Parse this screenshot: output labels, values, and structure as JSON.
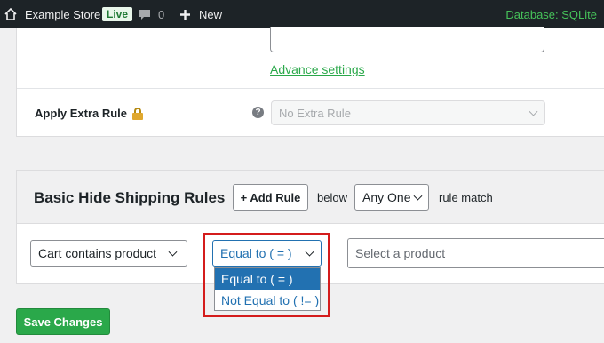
{
  "adminbar": {
    "site_name": "Example Store",
    "live_badge": "Live",
    "comment_count": "0",
    "new_label": "New",
    "database_label": "Database: SQLite",
    "icons": {
      "home": "home-icon",
      "comment": "comment-icon",
      "new": "plus-icon"
    }
  },
  "top_card": {
    "advance_link": "Advance settings",
    "extra_rule_label": "Apply Extra Rule",
    "extra_rule_placeholder": "No Extra Rule",
    "icons": {
      "lock": "lock-icon",
      "help": "help-icon"
    }
  },
  "rules": {
    "title": "Basic Hide Shipping Rules",
    "add_rule_label": "+ Add Rule",
    "below_label": "below",
    "match_select_value": "Any One",
    "rule_match_label": "rule match",
    "condition_select_value": "Cart contains product",
    "operator_select_value": "Equal to ( = )",
    "operator_options": [
      "Equal to ( = )",
      "Not Equal to ( != )"
    ],
    "product_placeholder": "Select a product"
  },
  "save_label": "Save Changes",
  "colors": {
    "accent_green": "#2aa84a",
    "highlight_red": "#d41c1c",
    "select_blue": "#2271b1",
    "adminbar_bg": "#1d2327"
  }
}
